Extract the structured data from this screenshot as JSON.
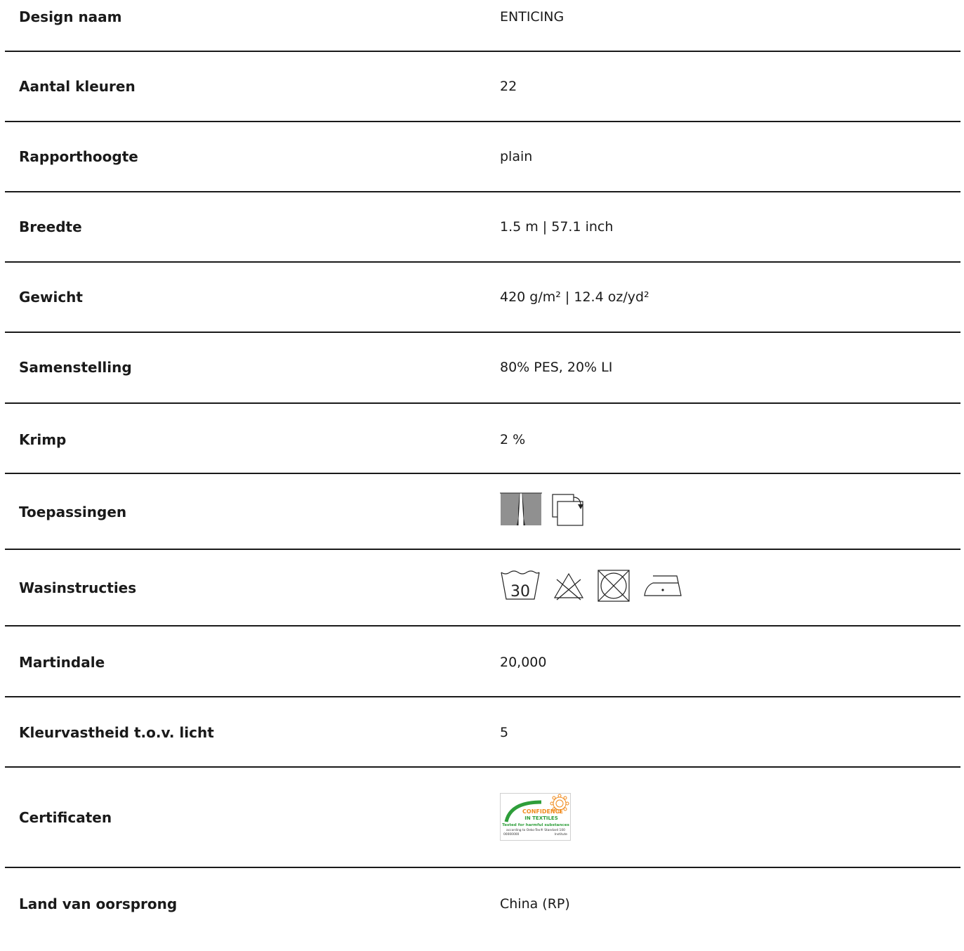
{
  "specs": {
    "design_name": {
      "label": "Design naam",
      "value": "ENTICING"
    },
    "color_count": {
      "label": "Aantal kleuren",
      "value": "22"
    },
    "repeat_height": {
      "label": "Rapporthoogte",
      "value": "plain"
    },
    "width": {
      "label": "Breedte",
      "value": "1.5 m | 57.1 inch"
    },
    "weight": {
      "label": "Gewicht",
      "value": "420 g/m² | 12.4 oz/yd²"
    },
    "composition": {
      "label": "Samenstelling",
      "value": "80% PES, 20% LI"
    },
    "shrinkage": {
      "label": "Krimp",
      "value": "2 %"
    },
    "applications": {
      "label": "Toepassingen",
      "icons": [
        "curtain-icon",
        "railroaded-fabric-icon"
      ]
    },
    "wash_instructions": {
      "label": "Wasinstructies",
      "icons": [
        "wash-30-icon",
        "no-bleach-icon",
        "no-tumble-dry-icon",
        "iron-low-icon"
      ],
      "wash_temp": "30"
    },
    "martindale": {
      "label": "Martindale",
      "value": "20,000"
    },
    "lightfastness": {
      "label": "Kleurvastheid t.o.v. licht",
      "value": "5"
    },
    "certificates": {
      "label": "Certificaten",
      "logo": {
        "name": "oeko-tex-logo",
        "line1": "CONFIDENCE",
        "line2": "IN TEXTILES",
        "line3": "Tested for harmful substances",
        "line4": "according to Oeko-Tex® Standard 100",
        "number": "00000000",
        "institute": "Institute",
        "green": "#2e9e3a",
        "orange": "#f08a1c"
      }
    },
    "origin": {
      "label": "Land van oorsprong",
      "value": "China (RP)"
    }
  }
}
